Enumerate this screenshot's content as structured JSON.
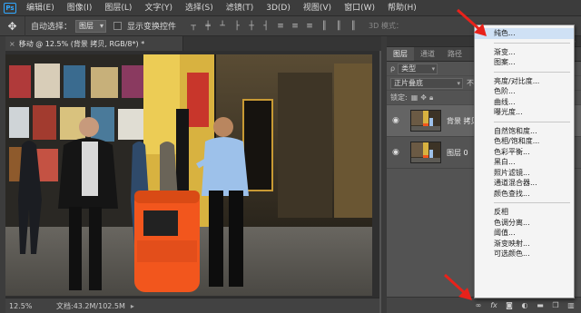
{
  "menubar": {
    "logo": "Ps",
    "items": [
      "编辑(E)",
      "图像(I)",
      "图层(L)",
      "文字(Y)",
      "选择(S)",
      "滤镜(T)",
      "3D(D)",
      "视图(V)",
      "窗口(W)",
      "帮助(H)"
    ]
  },
  "options": {
    "auto_select_label": "自动选择：",
    "auto_select_value": "图层",
    "show_transform_label": "显示变换控件",
    "mode_3d_label": "3D 模式："
  },
  "document": {
    "tab_title": "移动 @ 12.5% (背景 拷贝, RGB/8*) *",
    "zoom": "12.5%",
    "doc_info": "文档:43.2M/102.5M"
  },
  "layers_panel": {
    "tabs": [
      "图层",
      "通道",
      "路径"
    ],
    "kind_filter": "类型",
    "blend_mode": "正片叠底",
    "opacity_label": "不透",
    "lock_label": "锁定:",
    "layers": [
      {
        "name": "背景 拷贝",
        "visible": true,
        "selected": true
      },
      {
        "name": "图层 0",
        "visible": true,
        "selected": false
      }
    ],
    "bottom_icons": [
      "link-icon",
      "fx-icon",
      "mask-icon",
      "adjustment-icon",
      "folder-icon",
      "new-layer-icon",
      "trash-icon"
    ]
  },
  "context_menu": {
    "groups": [
      [
        "纯色..."
      ],
      [
        "渐变...",
        "图案..."
      ],
      [
        "亮度/对比度...",
        "色阶...",
        "曲线...",
        "曝光度..."
      ],
      [
        "自然饱和度...",
        "色相/饱和度...",
        "色彩平衡...",
        "黑白...",
        "照片滤镜...",
        "通道混合器...",
        "颜色查找..."
      ],
      [
        "反相",
        "色调分离...",
        "阈值...",
        "渐变映射...",
        "可选颜色..."
      ]
    ],
    "highlighted": "纯色..."
  },
  "colors": {
    "arrow": "#e8221b",
    "trash_can": "#f2561d",
    "shirt": "#9dc1ea"
  }
}
